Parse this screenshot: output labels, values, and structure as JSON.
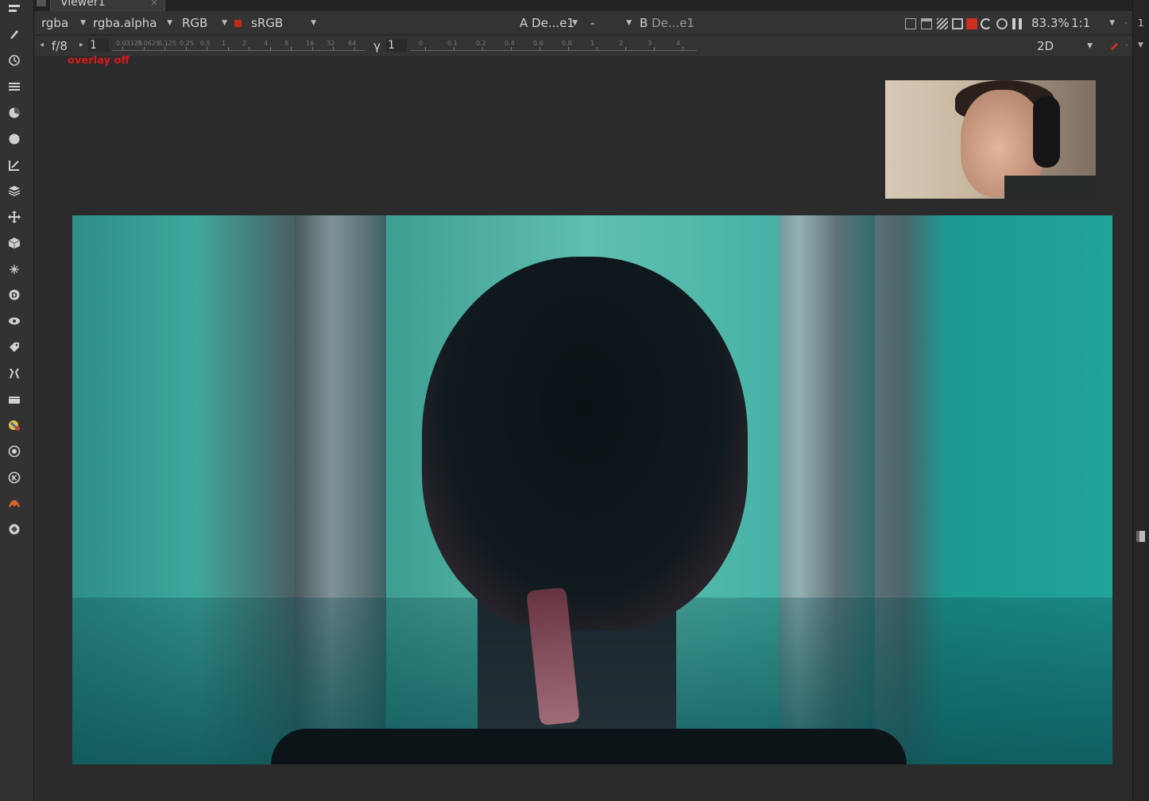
{
  "tab": {
    "title": "Viewer1",
    "close": "×"
  },
  "channels": {
    "layer": "rgba",
    "alpha": "rgba.alpha",
    "display": "RGB",
    "lut": "sRGB"
  },
  "inputs": {
    "a_label": "A",
    "a_value": "De...e1",
    "mode": "-",
    "b_label": "B",
    "b_value": "De...e1"
  },
  "view": {
    "zoom": "83.3%",
    "proxy": "1:1",
    "mode": "2D"
  },
  "gain": {
    "fstop": "f/8",
    "value": "1",
    "ticks": [
      "0.03125",
      "0.0625",
      "0.125",
      "0.25",
      "0.5",
      "1",
      "2",
      "4",
      "8",
      "16",
      "32",
      "64"
    ]
  },
  "gamma": {
    "label": "γ",
    "value": "1",
    "ticks": [
      "0",
      "0.1",
      "0.2",
      "0.4",
      "0.6",
      "0.8",
      "1",
      "2",
      "3",
      "4"
    ]
  },
  "overlay": {
    "status": "overlay off",
    "color": "#d61a1a"
  },
  "toolbar_icons": [
    "nodegraph-icon",
    "paint-icon",
    "time-icon",
    "channel-icon",
    "color-icon",
    "filter-icon",
    "keyer-icon",
    "merge-icon",
    "transform-icon",
    "3d-icon",
    "particles-icon",
    "deep-icon",
    "views-icon",
    "metadata-icon",
    "toolsets-icon",
    "other-icon",
    "furnace-icon",
    "ocio-icon",
    "keylight-icon",
    "bokeh-icon",
    "plugins-icon"
  ],
  "right_panel": {
    "number": "1"
  }
}
